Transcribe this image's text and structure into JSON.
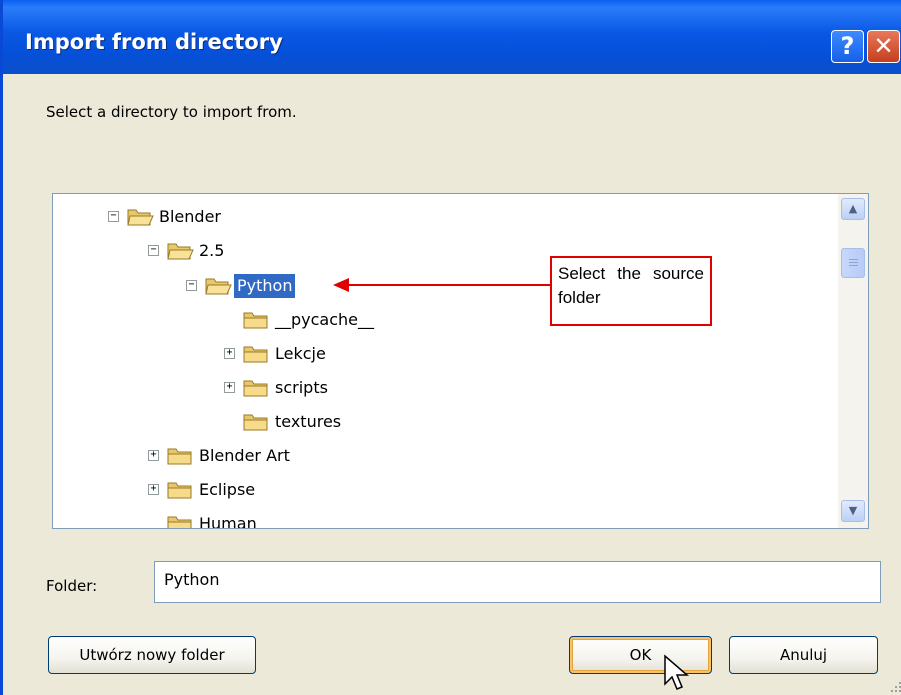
{
  "window": {
    "title": "Import from directory",
    "help_label": "?",
    "close_label": "✕"
  },
  "prompt": "Select a directory to import from.",
  "tree": [
    {
      "label": "Blender",
      "expander": "−",
      "icon": "folder-open-icon"
    },
    {
      "label": "2.5",
      "expander": "−",
      "icon": "folder-open-icon"
    },
    {
      "label": "Python",
      "expander": "−",
      "icon": "folder-open-icon",
      "selected": true
    },
    {
      "label": "__pycache__",
      "expander": "",
      "icon": "folder-icon"
    },
    {
      "label": "Lekcje",
      "expander": "+",
      "icon": "folder-icon"
    },
    {
      "label": "scripts",
      "expander": "+",
      "icon": "folder-icon"
    },
    {
      "label": "textures",
      "expander": "",
      "icon": "folder-icon"
    },
    {
      "label": "Blender Art",
      "expander": "+",
      "icon": "folder-icon"
    },
    {
      "label": "Eclipse",
      "expander": "+",
      "icon": "folder-icon"
    },
    {
      "label": "Human",
      "expander": "",
      "icon": "folder-icon"
    }
  ],
  "callout": {
    "text": "Select the source folder",
    "color": "#e00000"
  },
  "folder": {
    "label": "Folder:",
    "value": "Python"
  },
  "buttons": {
    "new_folder": "Utwórz nowy folder",
    "ok": "OK",
    "cancel": "Anuluj"
  },
  "colors": {
    "titlebar": "#0957e4",
    "selection": "#316ac5",
    "dialog_bg": "#ece9d8"
  }
}
